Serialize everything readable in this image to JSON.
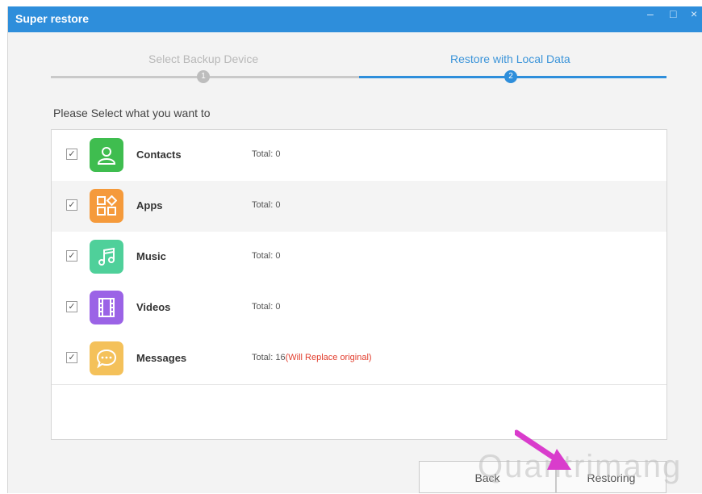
{
  "window": {
    "title": "Super restore",
    "controls": {
      "minimize": "–",
      "maximize": "□",
      "close": "×"
    }
  },
  "steps": [
    {
      "number": "1",
      "label": "Select Backup Device",
      "state": "inactive"
    },
    {
      "number": "2",
      "label": "Restore with Local Data",
      "state": "active"
    }
  ],
  "prompt": "Please Select what you want to",
  "items": [
    {
      "name": "Contacts",
      "total": "Total: 0",
      "note": "",
      "checked": true,
      "icon": "contacts-icon",
      "color": "#3fbd4f"
    },
    {
      "name": "Apps",
      "total": "Total: 0",
      "note": "",
      "checked": true,
      "icon": "apps-icon",
      "color": "#f59a3b"
    },
    {
      "name": "Music",
      "total": "Total: 0",
      "note": "",
      "checked": true,
      "icon": "music-icon",
      "color": "#4fd09a"
    },
    {
      "name": "Videos",
      "total": "Total: 0",
      "note": "",
      "checked": true,
      "icon": "videos-icon",
      "color": "#9b63e6"
    },
    {
      "name": "Messages",
      "total": "Total: 16",
      "note": "(Will Replace original)",
      "checked": true,
      "icon": "messages-icon",
      "color": "#f4c15a"
    }
  ],
  "buttons": {
    "back": "Back",
    "restoring": "Restoring"
  },
  "watermark": "Quantrimang",
  "colors": {
    "accent": "#2e8edb",
    "warning": "#e23d2d",
    "arrow": "#d93ccc"
  }
}
